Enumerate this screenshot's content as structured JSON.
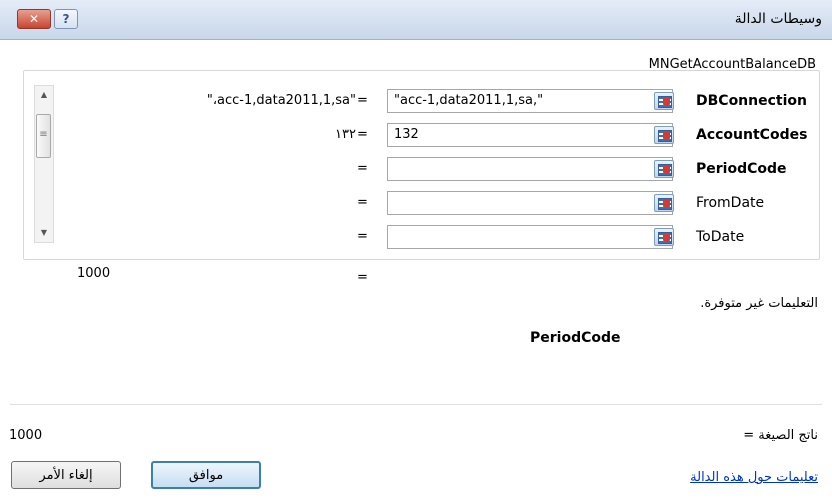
{
  "dialog": {
    "title": "وسيطات الدالة",
    "help_button": "?",
    "close_button": "✕"
  },
  "function_name": "MNGetAccountBalanceDB",
  "arguments": [
    {
      "label": "DBConnection",
      "value": "\"acc-1,data2011,1,sa,\"",
      "evaluated": "\"،acc-1,data2011,1,sa\"",
      "equals": "=",
      "required": true
    },
    {
      "label": "AccountCodes",
      "value": "132",
      "evaluated": "١٣٢",
      "equals": "=",
      "required": true
    },
    {
      "label": "PeriodCode",
      "value": "",
      "evaluated": "",
      "equals": "=",
      "required": true
    },
    {
      "label": "FromDate",
      "value": "",
      "evaluated": "",
      "equals": "=",
      "required": false
    },
    {
      "label": "ToDate",
      "value": "",
      "evaluated": "",
      "equals": "=",
      "required": false
    }
  ],
  "result": {
    "value": "1000",
    "equals": "="
  },
  "description": "التعليمات غير متوفرة.",
  "focused_argument": "PeriodCode",
  "formula_result": {
    "label": "ناتج الصيغة =",
    "value": "1000"
  },
  "help_link": "تعليمات حول هذه الدالة",
  "buttons": {
    "ok": "موافق",
    "cancel": "إلغاء الأمر"
  },
  "colors": {
    "titlebar": "#c9d7ea",
    "link": "#0033cc",
    "close": "#c8452f"
  }
}
